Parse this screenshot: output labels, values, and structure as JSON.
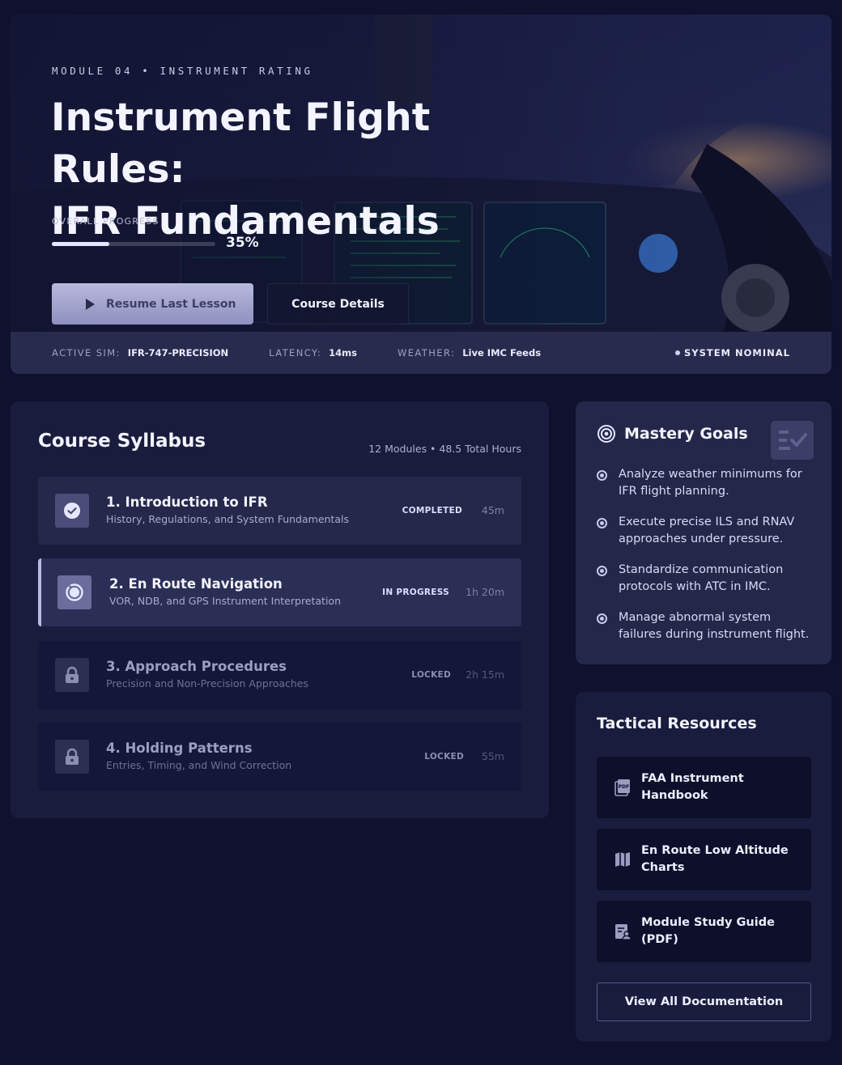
{
  "hero": {
    "eyebrow": "MODULE 04 • INSTRUMENT RATING",
    "title_line1": "Instrument Flight Rules:",
    "title_line2": "IFR Fundamentals",
    "progress_label": "OVERALL PROGRESS",
    "progress_value": "35%",
    "progress_fraction": 0.35,
    "resume_label": "Resume Last Lesson",
    "details_label": "Course Details"
  },
  "status_bar": {
    "sim_key": "ACTIVE SIM:",
    "sim_val": "IFR-747-PRECISION",
    "latency_key": "LATENCY:",
    "latency_val": "14ms",
    "weather_key": "WEATHER:",
    "weather_val": "Live IMC Feeds",
    "system_status": "SYSTEM NOMINAL"
  },
  "syllabus": {
    "title": "Course Syllabus",
    "meta": "12 Modules • 48.5 Total Hours",
    "modules": [
      {
        "name": "1. Introduction to IFR",
        "subtitle": "History, Regulations, and System Fundamentals",
        "status": "COMPLETED",
        "duration": "45m",
        "icon": "check-icon"
      },
      {
        "name": "2. En Route Navigation",
        "subtitle": "VOR, NDB, and GPS Instrument Interpretation",
        "status": "IN PROGRESS",
        "duration": "1h 20m",
        "icon": "progress-ring-icon"
      },
      {
        "name": "3. Approach Procedures",
        "subtitle": "Precision and Non-Precision Approaches",
        "status": "LOCKED",
        "duration": "2h 15m",
        "icon": "lock-icon"
      },
      {
        "name": "4. Holding Patterns",
        "subtitle": "Entries, Timing, and Wind Correction",
        "status": "LOCKED",
        "duration": "55m",
        "icon": "lock-icon"
      }
    ]
  },
  "mastery": {
    "title": "Mastery Goals",
    "icon": "target-icon",
    "badge_icon": "checklist-icon",
    "goals": [
      "Analyze weather minimums for IFR flight planning.",
      "Execute precise ILS and RNAV approaches under pressure.",
      "Standardize communication protocols with ATC in IMC.",
      "Manage abnormal system failures during instrument flight."
    ]
  },
  "resources": {
    "title": "Tactical Resources",
    "items": [
      {
        "label": "FAA Instrument Handbook",
        "icon": "pdf-icon"
      },
      {
        "label": "En Route Low Altitude Charts",
        "icon": "map-icon"
      },
      {
        "label": "Module Study Guide (PDF)",
        "icon": "study-guide-icon"
      }
    ],
    "view_all_label": "View All Documentation"
  },
  "colors": {
    "background": "#10112e",
    "card": "#1a1c3d",
    "accent": "#b7b9e6"
  }
}
